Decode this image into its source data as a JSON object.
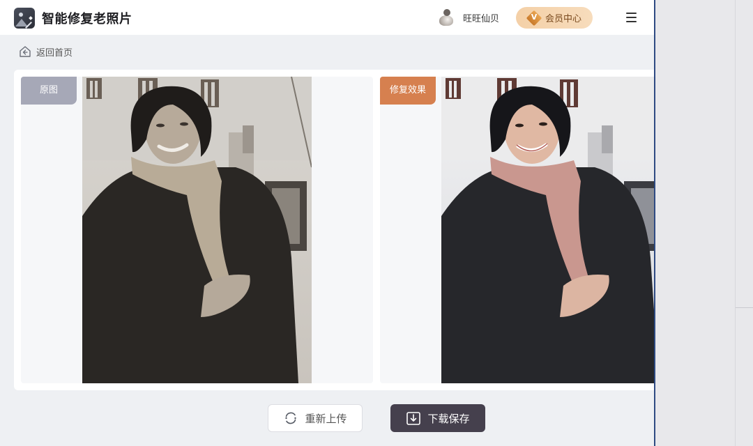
{
  "header": {
    "app_title": "智能修复老照片",
    "username": "旺旺仙贝",
    "vip_label": "会员中心",
    "vip_badge_letter": "V"
  },
  "nav": {
    "back_label": "返回首页"
  },
  "compare": {
    "original_tag": "原图",
    "restored_tag": "修复效果"
  },
  "actions": {
    "reupload_label": "重新上传",
    "download_label": "下载保存"
  },
  "colors": {
    "accent_vip": "#f4d0a7",
    "restored_tag": "#d6804f",
    "original_tag": "#a6a8b7",
    "download_button": "#45404d"
  },
  "icons": {
    "logo": "photo-restore-logo-icon",
    "home": "home-icon",
    "menu": "hamburger-menu-icon",
    "reupload": "refresh-icon",
    "download": "download-icon"
  }
}
